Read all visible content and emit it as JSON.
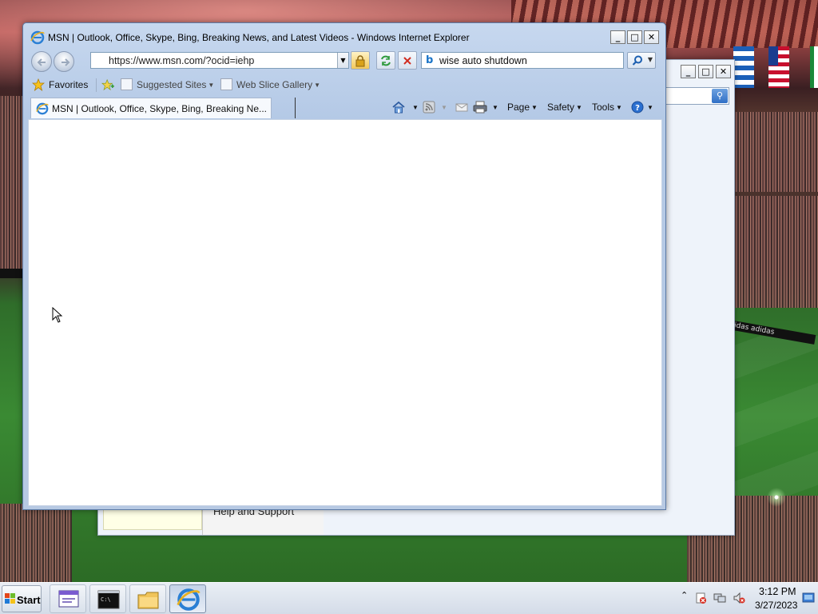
{
  "ie": {
    "title": "MSN | Outlook, Office, Skype, Bing, Breaking News, and Latest Videos - Windows Internet Explorer",
    "caption_buttons": {
      "minimize": "_",
      "maximize": "□",
      "close": "✕"
    },
    "address": "https://www.msn.com/?ocid=iehp",
    "search_value": "wise auto shutdown",
    "search_provider_icon": "b",
    "favorites_label": "Favorites",
    "favorites_links": [
      {
        "label": "Suggested Sites"
      },
      {
        "label": "Web Slice Gallery"
      }
    ],
    "tab_title": "MSN | Outlook, Office, Skype, Bing, Breaking Ne...",
    "command_bar": {
      "page": "Page",
      "safety": "Safety",
      "tools": "Tools"
    }
  },
  "background_window": {
    "help_label": "Help and Support",
    "caption_buttons": {
      "minimize": "_",
      "maximize": "□",
      "close": "✕"
    }
  },
  "desktop": {
    "ad_text": "adidas  adidas  adidas  adidas"
  },
  "taskbar": {
    "start_label": "Start",
    "time": "3:12 PM",
    "date": "3/27/2023"
  },
  "colors": {
    "window_frame": "#b4c9e6",
    "title_text": "#000000",
    "taskbar": "#dde4ee"
  }
}
